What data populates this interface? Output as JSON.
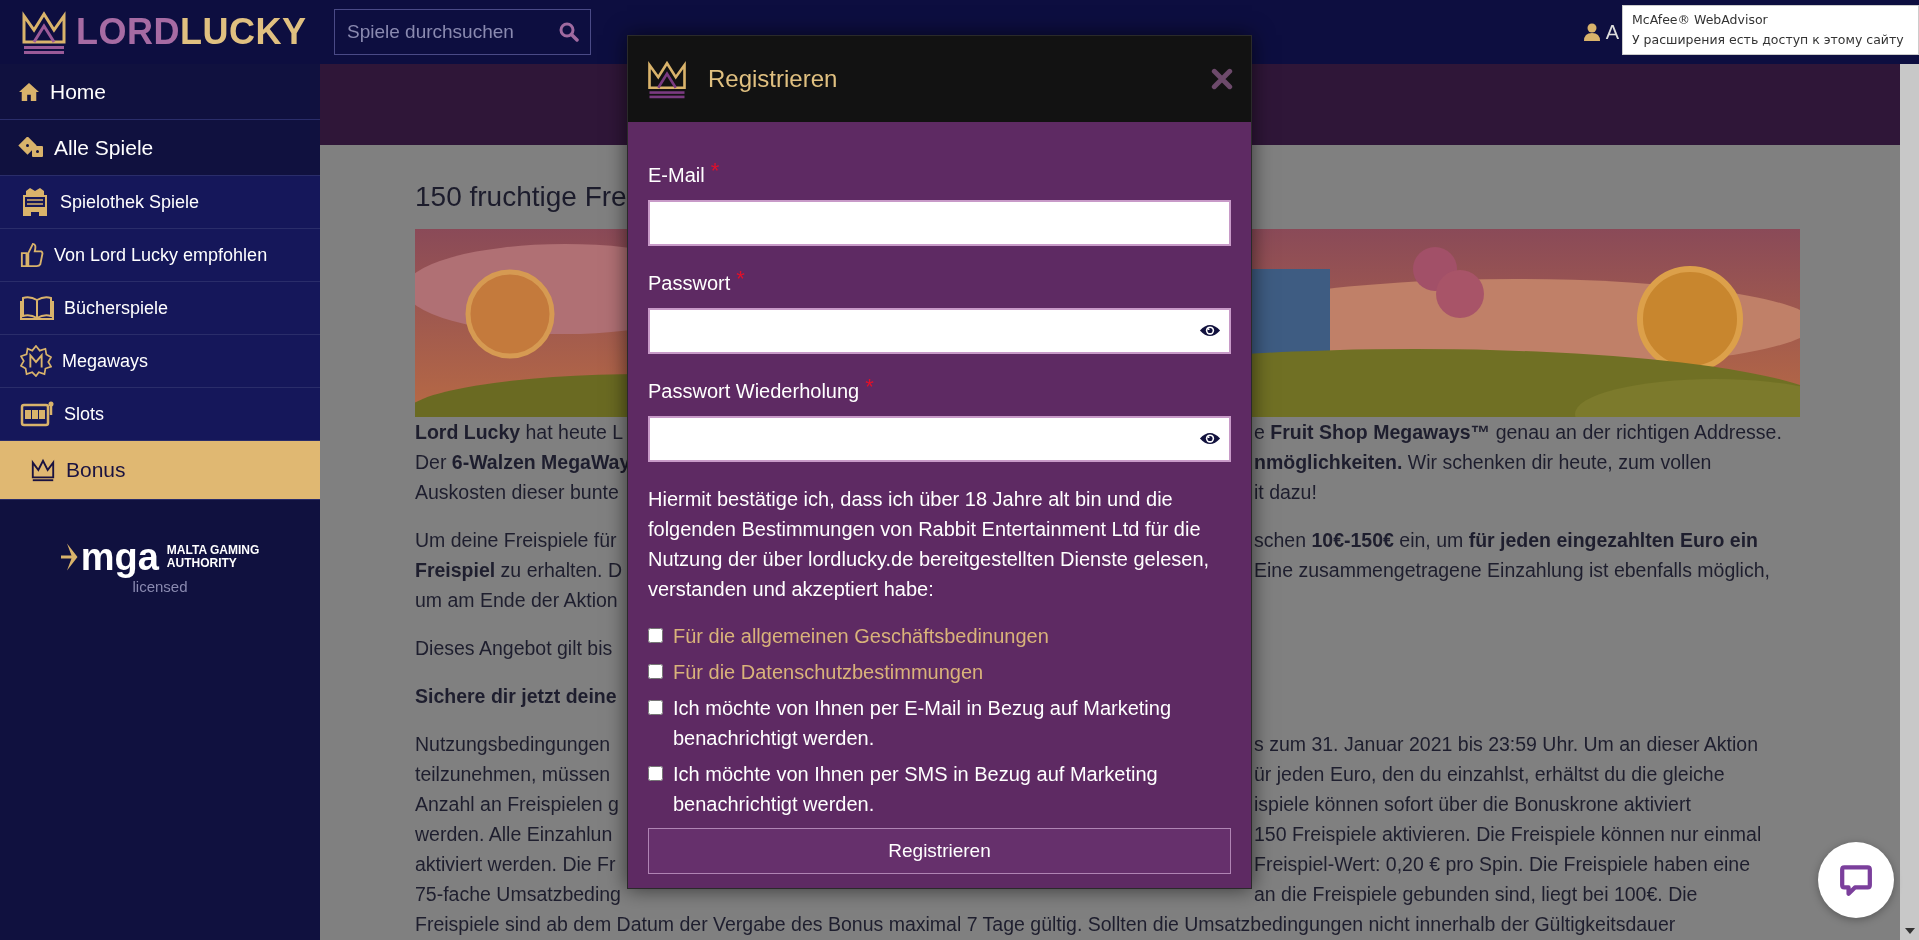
{
  "header": {
    "logo_left": "LORD",
    "logo_right": "LUCKY",
    "search": {
      "placeholder": "Spiele durchsuchen"
    },
    "account_text": "A"
  },
  "sidebar": {
    "items": [
      {
        "label": "Home",
        "kind": "main",
        "selected": false
      },
      {
        "label": "Alle Spiele",
        "kind": "main",
        "selected": false
      },
      {
        "label": "Spielothek Spiele",
        "kind": "category",
        "selected": false
      },
      {
        "label": "Von Lord Lucky empfohlen",
        "kind": "category",
        "selected": false
      },
      {
        "label": "Bücherspiele",
        "kind": "category",
        "selected": false
      },
      {
        "label": "Megaways",
        "kind": "category",
        "selected": false
      },
      {
        "label": "Slots",
        "kind": "category",
        "selected": false
      },
      {
        "label": "Bonus",
        "kind": "category",
        "selected": true
      }
    ],
    "license": {
      "logo_text": "mga",
      "authority_lines": [
        "MALTA GAMING",
        "AUTHORITY"
      ],
      "note": "licensed"
    }
  },
  "article": {
    "title": "150 fruchtige Fre",
    "paragraphs": [
      {
        "kind": "text",
        "lines": [
          {
            "left": "**Lord Lucky** hat heute L",
            "right": "e **Fruit Shop Megaways™** genau an der richtigen Addresse."
          },
          {
            "left": "Der **6-Walzen MegaWay**",
            "right": "**nmöglichkeiten.** Wir schenken dir heute, zum vollen"
          },
          {
            "left": "Auskosten dieser bunte",
            "right": "it dazu!"
          }
        ]
      },
      {
        "kind": "text",
        "lines": [
          {
            "left": "Um deine Freispiele für",
            "right": "schen **10€-150€** ein, um **für jeden eingezahlten Euro ein**"
          },
          {
            "left": "**Freispiel** zu erhalten. D",
            "right": "Eine zusammengetragene Einzahlung ist ebenfalls möglich,"
          },
          {
            "left": "um am Ende der Aktion"
          }
        ]
      },
      {
        "kind": "text",
        "lines": [
          {
            "left": "Dieses Angebot gilt bis"
          }
        ]
      },
      {
        "kind": "heading",
        "lines": [
          {
            "left": "Sichere dir jetzt deine"
          }
        ]
      },
      {
        "kind": "text",
        "lines": [
          {
            "left": "Nutzungsbedingungen",
            "right": "s zum 31. Januar 2021 bis 23:59 Uhr. Um an dieser Aktion"
          },
          {
            "left": "teilzunehmen, müssen",
            "right": "ür jeden Euro, den du einzahlst, erhältst du die gleiche"
          },
          {
            "left": "Anzahl an Freispielen g",
            "right": "ispiele können sofort über die Bonuskrone aktiviert"
          },
          {
            "left": "werden. Alle Einzahlun",
            "right": "150 Freispiele aktivieren. Die Freispiele können nur einmal"
          },
          {
            "left": "aktiviert werden. Die Fr",
            "right": "Freispiel-Wert: 0,20 € pro Spin. Die Freispiele haben eine"
          },
          {
            "left": "75-fache Umsatzbeding",
            "right": "an die Freispiele gebunden sind, liegt bei 100€. Die"
          }
        ]
      }
    ],
    "last_line": "Freispiele sind ab dem Datum der Vergabe des Bonus maximal 7 Tage gültig. Sollten die Umsatzbedingungen nicht innerhalb der Gültigkeitsdauer"
  },
  "dialog": {
    "title": "Registrieren",
    "fields": [
      {
        "label": "E-Mail",
        "required_mark": "*",
        "kind": "text"
      },
      {
        "label": "Passwort",
        "required_mark": "*",
        "kind": "password"
      },
      {
        "label": "Passwort Wiederholung",
        "required_mark": "*",
        "kind": "password"
      }
    ],
    "consent_text": "Hiermit bestätige ich, dass ich über 18 Jahre alt bin und die folgenden Bestimmungen von Rabbit Entertainment Ltd für die Nutzung der über lordlucky.de bereitgestellten Dienste gelesen, verstanden und akzeptiert habe:",
    "checkboxes": [
      {
        "label": "Für die allgemeinen Geschäftsbedinungen",
        "kind": "link",
        "checked": false
      },
      {
        "label": "Für die Datenschutzbestimmungen",
        "kind": "link",
        "checked": false
      },
      {
        "label": "Ich möchte von Ihnen per E-Mail in Bezug auf Marketing benachrichtigt werden.",
        "kind": "text",
        "checked": false
      },
      {
        "label": "Ich möchte von Ihnen per SMS in Bezug auf Marketing benachrichtigt werden.",
        "kind": "text",
        "checked": false
      }
    ],
    "submit": "Registrieren"
  },
  "extension_tooltip": {
    "title": "McAfee® WebAdvisor",
    "text": "У расширения есть доступ к этому сайту"
  }
}
